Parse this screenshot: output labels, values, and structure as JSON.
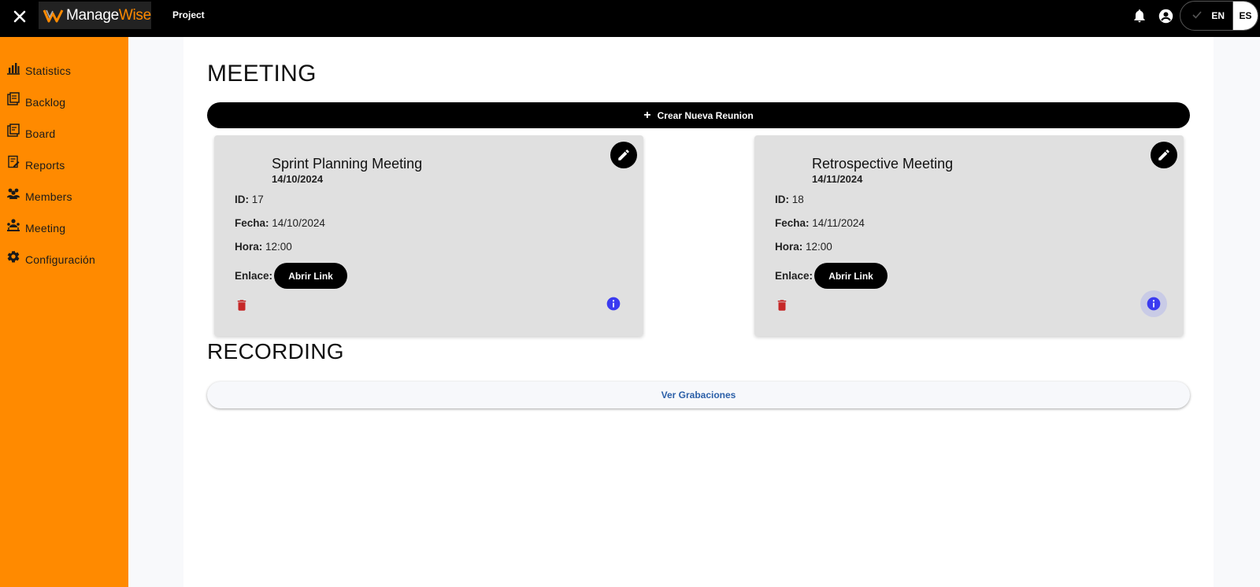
{
  "header": {
    "logo_part1": "Manage",
    "logo_part2": "Wise",
    "project_label": "Project",
    "lang_en": "EN",
    "lang_es": "ES",
    "accent_color": "#ff8a00"
  },
  "sidebar": {
    "items": [
      {
        "label": "Statistics",
        "icon": "bar-chart-icon"
      },
      {
        "label": "Backlog",
        "icon": "backlog-icon"
      },
      {
        "label": "Board",
        "icon": "board-icon"
      },
      {
        "label": "Reports",
        "icon": "report-icon"
      },
      {
        "label": "Members",
        "icon": "members-icon"
      },
      {
        "label": "Meeting",
        "icon": "meeting-icon"
      },
      {
        "label": "Configuración",
        "icon": "gear-icon"
      }
    ]
  },
  "main": {
    "meeting_title": "MEETING",
    "create_button": "Crear Nueva Reunion",
    "recording_title": "RECORDING",
    "recordings_button": "Ver Grabaciones",
    "field_labels": {
      "id": "ID:",
      "date": "Fecha:",
      "time": "Hora:",
      "link": "Enlace:"
    },
    "link_button": "Abrir Link",
    "meetings": [
      {
        "title": "Sprint Planning Meeting",
        "subtitle": "14/10/2024",
        "id": "17",
        "date": "14/10/2024",
        "time": "12:00"
      },
      {
        "title": "Retrospective Meeting",
        "subtitle": "14/11/2024",
        "id": "18",
        "date": "14/11/2024",
        "time": "12:00"
      }
    ]
  }
}
